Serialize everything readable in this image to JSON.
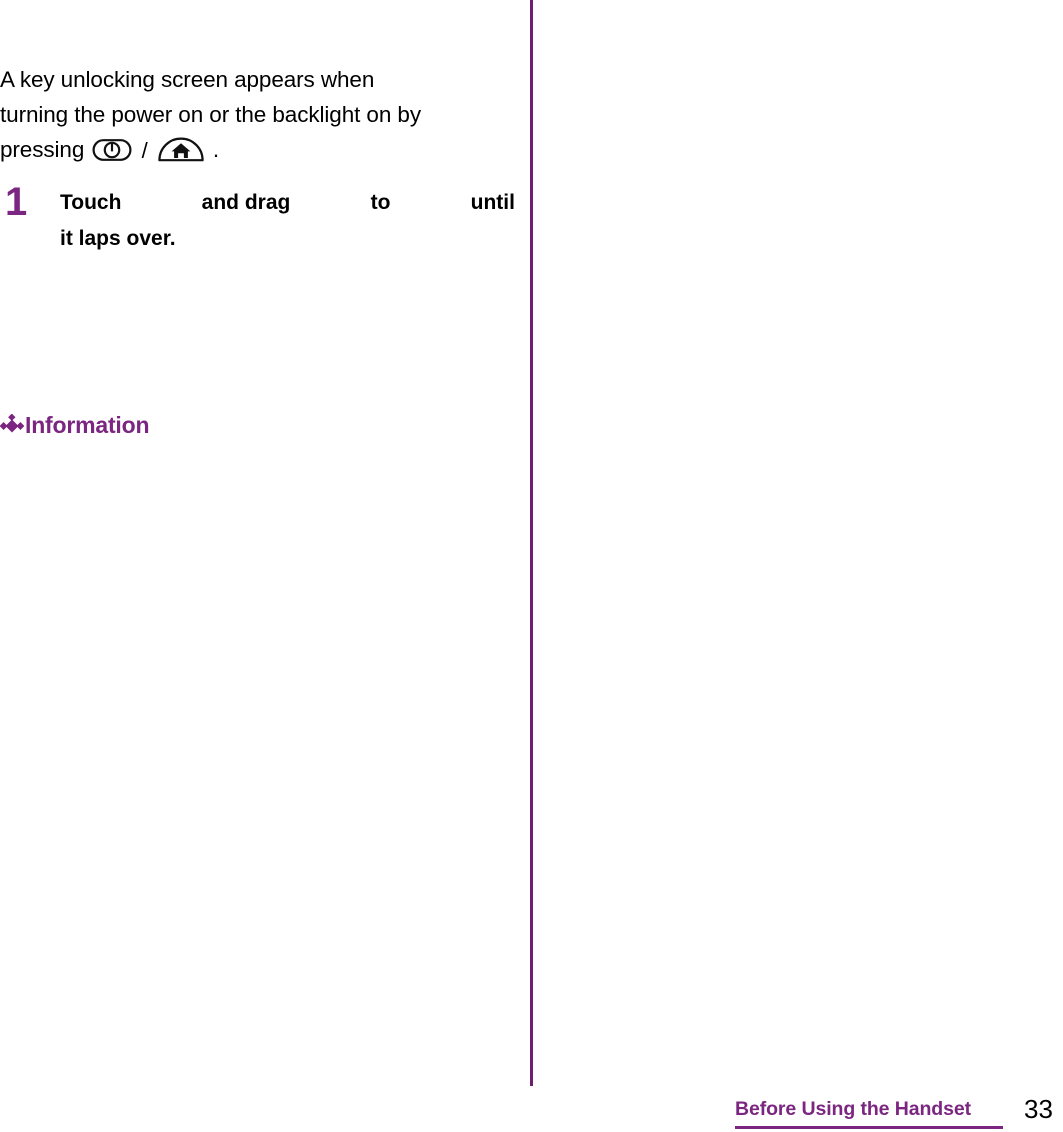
{
  "document": {
    "background_color": "#ffffff",
    "accent_color": "#7B2680",
    "divider_color": "#6E1F6E"
  },
  "body_text": {
    "intro": {
      "line1": "A key unlocking screen appears when",
      "line2": "turning the power on or the backlight on by",
      "line3_prefix": "pressing",
      "key_separator": "/",
      "line3_suffix": "."
    }
  },
  "step": {
    "number": "1",
    "line1_words": [
      "Touch",
      "and drag",
      "to",
      "until"
    ],
    "line2": "it laps over."
  },
  "information": {
    "icon": "diamond-cluster-icon",
    "label": "Information"
  },
  "icons": {
    "power_key": "power-key-icon",
    "home_key": "home-key-icon"
  },
  "footer": {
    "section_title": "Before Using the Handset",
    "page_number": "33"
  }
}
